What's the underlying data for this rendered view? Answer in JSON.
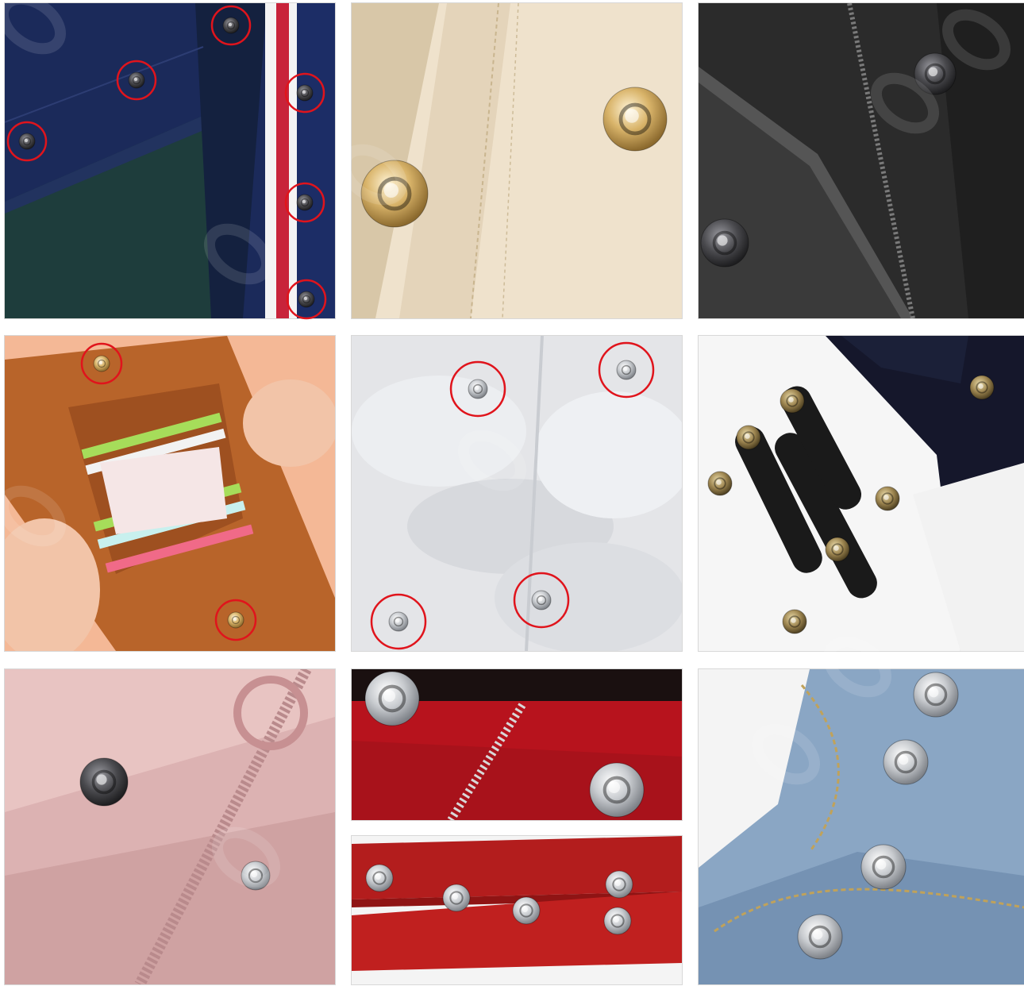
{
  "photos": [
    {
      "id": "navy-jacket-stripe-snaps",
      "highlighted_snaps": 6
    },
    {
      "id": "beige-coat-gold-snaps",
      "highlighted_snaps": 0
    },
    {
      "id": "black-jacket-zipper-snaps",
      "highlighted_snaps": 0
    },
    {
      "id": "tan-leather-card-wallet-snaps",
      "highlighted_snaps": 2
    },
    {
      "id": "white-puffer-silver-snaps",
      "highlighted_snaps": 4
    },
    {
      "id": "black-leather-strap-snaps",
      "highlighted_snaps": 0
    },
    {
      "id": "pink-jacket-zipper-snaps",
      "highlighted_snaps": 0
    },
    {
      "id": "red-fabric-silver-snaps",
      "highlighted_snaps": 0
    },
    {
      "id": "red-webbing-strap-snaps",
      "highlighted_snaps": 0
    },
    {
      "id": "denim-jeans-metal-snaps",
      "highlighted_snaps": 0
    }
  ],
  "colors": {
    "highlight_circle": "#e0141c",
    "navy": "#1b2a5a",
    "beige": "#efe2cc",
    "charcoal": "#2b2b2b",
    "tan_leather": "#b8642a",
    "peach_bg": "#f4b896",
    "white_puffer": "#e4e5e8",
    "pink": "#dcb2b2",
    "red_fabric": "#a8121b",
    "denim": "#8aa6c4",
    "gold": "#d9b46a",
    "silver": "#c9ccd0",
    "gunmetal": "#4a4a4e",
    "watermark": "#e6e6e6"
  }
}
